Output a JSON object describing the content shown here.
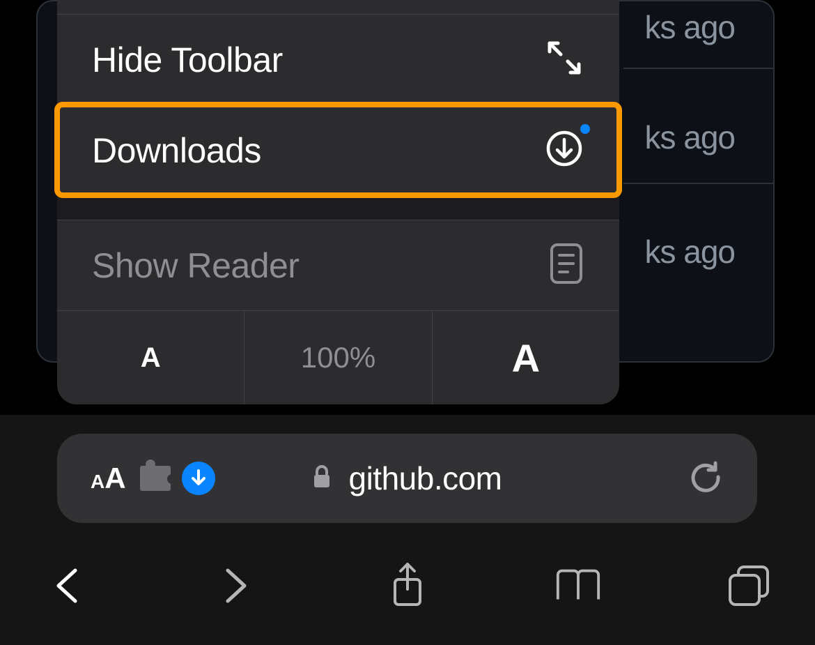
{
  "background_rows": {
    "t0": "ks ago",
    "t1": "ks ago",
    "t2": "ks ago"
  },
  "popover": {
    "items": [
      {
        "label": "Hide Toolbar"
      },
      {
        "label": "Downloads"
      },
      {
        "label": "Show Reader"
      }
    ],
    "zoom": {
      "small": "A",
      "value": "100%",
      "large": "A"
    }
  },
  "address_bar": {
    "text_size_small": "A",
    "text_size_large": "A",
    "url": "github.com"
  },
  "colors": {
    "accent_blue": "#0a84ff",
    "highlight_orange": "#ff9900"
  }
}
